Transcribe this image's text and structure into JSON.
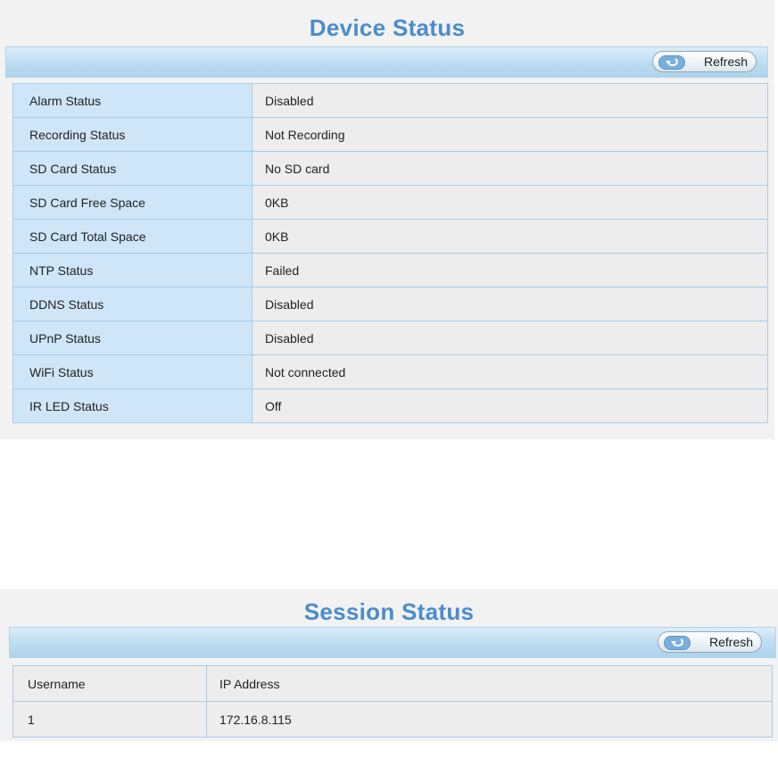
{
  "device_status": {
    "title": "Device Status",
    "refresh_label": "Refresh",
    "rows": [
      {
        "label": "Alarm Status",
        "value": "Disabled"
      },
      {
        "label": "Recording Status",
        "value": "Not Recording"
      },
      {
        "label": "SD Card Status",
        "value": "No SD card"
      },
      {
        "label": "SD Card Free Space",
        "value": "0KB"
      },
      {
        "label": "SD Card Total Space",
        "value": "0KB"
      },
      {
        "label": "NTP Status",
        "value": "Failed"
      },
      {
        "label": "DDNS Status",
        "value": "Disabled"
      },
      {
        "label": "UPnP Status",
        "value": "Disabled"
      },
      {
        "label": "WiFi Status",
        "value": "Not connected"
      },
      {
        "label": "IR LED Status",
        "value": "Off"
      }
    ]
  },
  "session_status": {
    "title": "Session Status",
    "refresh_label": "Refresh",
    "headers": [
      "Username",
      "IP Address"
    ],
    "rows": [
      {
        "username": "1",
        "ip": "172.16.8.115"
      }
    ]
  },
  "colors": {
    "title": "#4a8ccd",
    "key_cell": "#cfe6f8",
    "value_cell": "#ededed",
    "border": "#a8cde9",
    "panel_bg": "#f2f2f2"
  },
  "icons": {
    "refresh": "refresh-icon"
  }
}
